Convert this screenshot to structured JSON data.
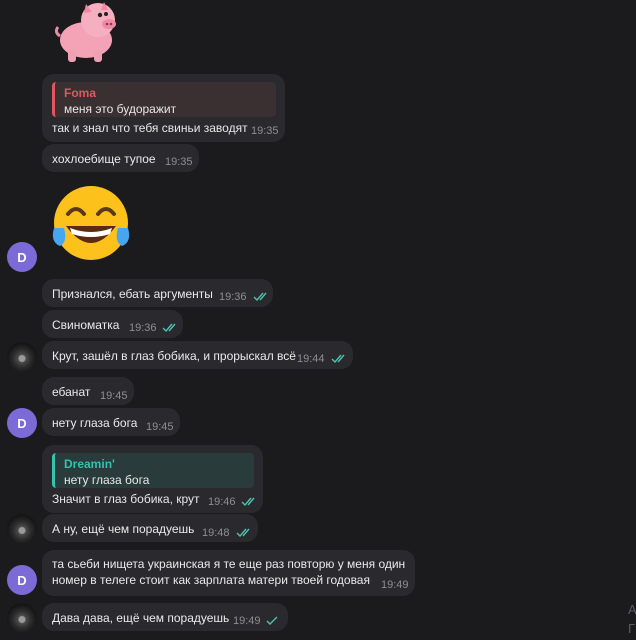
{
  "theme": {
    "background": "#1b1b1d",
    "bubble": "#2a2a2e",
    "time_color": "#8d8d93",
    "check_color": "#4fc1b0",
    "foma_accent": "#e2575f",
    "dreamin_accent": "#34c3ad",
    "avatar_d_color": "#7c6ad6"
  },
  "avatars": {
    "d_letter": "D"
  },
  "messages": [
    {
      "text": "так и знал что тебя свиньи заводят",
      "time": "19:35",
      "reply": {
        "author": "Foma",
        "text": "меня это будоражит"
      }
    },
    {
      "text": "хохлоебище тупое",
      "time": "19:35"
    },
    {
      "text": "Признался, ебать аргументы",
      "time": "19:36",
      "read": true
    },
    {
      "text": "Свиноматка",
      "time": "19:36",
      "read": true
    },
    {
      "text": "Крут, зашёл в глаз бобика, и прорыскал всё",
      "time": "19:44",
      "read": true
    },
    {
      "text": "ебанат",
      "time": "19:45"
    },
    {
      "text": "нету глаза бога",
      "time": "19:45"
    },
    {
      "text": "Значит в глаз бобика, крут",
      "time": "19:46",
      "read": true,
      "reply": {
        "author": "Dreamin'",
        "text": "нету глаза бога"
      }
    },
    {
      "text": "А ну, ещё чем порадуешь",
      "time": "19:48",
      "read": true
    },
    {
      "line1": "та сьеби нищета украинская я те еще раз повторю у меня один",
      "line2": "номер в телеге стоит как зарплата матери твоей годовая",
      "time": "19:49"
    },
    {
      "text": "Дава дава, ещё чем порадуешь",
      "time": "19:49",
      "read": true,
      "single_check": true
    }
  ],
  "edge": {
    "char1": "А",
    "char2": "Г"
  }
}
